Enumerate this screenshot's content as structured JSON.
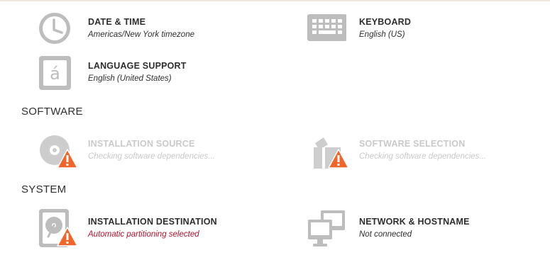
{
  "localization": {
    "date_time": {
      "title": "DATE & TIME",
      "status": "Americas/New York timezone",
      "icon": "clock-icon"
    },
    "keyboard": {
      "title": "KEYBOARD",
      "status": "English (US)",
      "icon": "keyboard-icon"
    },
    "language": {
      "title": "LANGUAGE SUPPORT",
      "status": "English (United States)",
      "icon": "language-icon"
    }
  },
  "software": {
    "heading": "SOFTWARE",
    "installation_source": {
      "title": "INSTALLATION SOURCE",
      "status": "Checking software dependencies...",
      "icon": "disc-icon",
      "warning": true,
      "disabled": true
    },
    "software_selection": {
      "title": "SOFTWARE SELECTION",
      "status": "Checking software dependencies...",
      "icon": "package-icon",
      "warning": true,
      "disabled": true
    }
  },
  "system": {
    "heading": "SYSTEM",
    "installation_destination": {
      "title": "INSTALLATION DESTINATION",
      "status": "Automatic partitioning selected",
      "icon": "harddisk-icon",
      "warning": true
    },
    "network_hostname": {
      "title": "NETWORK & HOSTNAME",
      "status": "Not connected",
      "icon": "network-icon"
    }
  },
  "colors": {
    "icon_gray": "#b7b7b7",
    "warning_orange": "#f0652a",
    "error_red": "#b3112d",
    "text": "#2e2e2e",
    "disabled_text": "#c9c9c9"
  }
}
